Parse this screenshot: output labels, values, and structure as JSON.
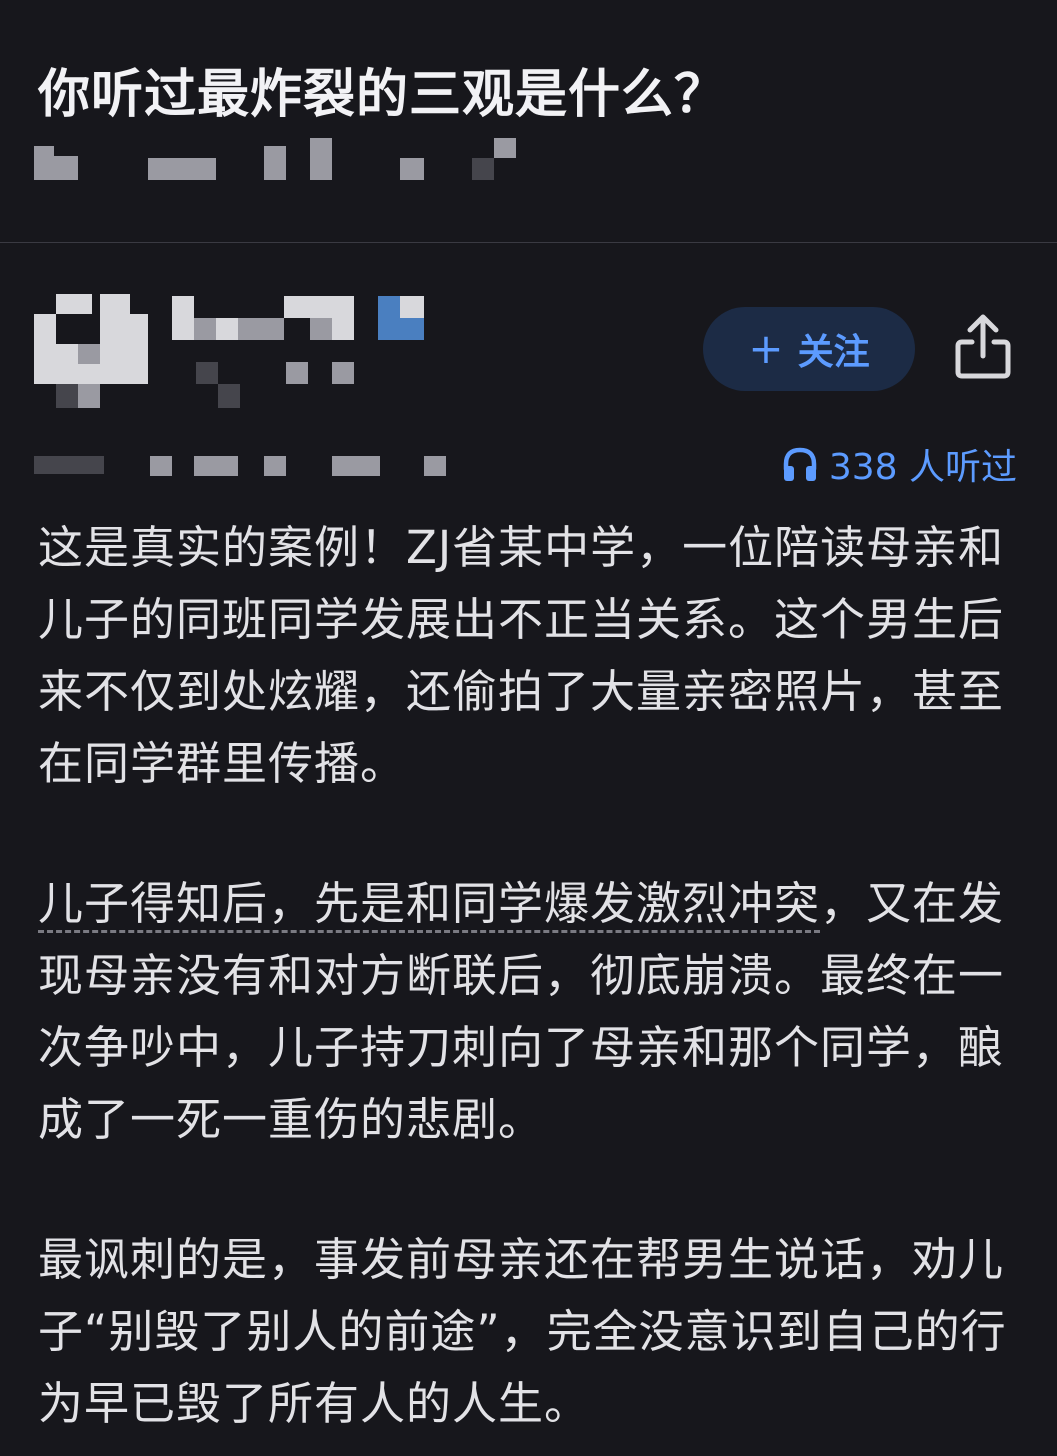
{
  "question": {
    "title": "你听过最炸裂的三观是什么？"
  },
  "author": {
    "follow_label": "关注",
    "follow_icon": "plus-icon",
    "share_icon": "share-icon"
  },
  "stats": {
    "listen_icon": "headphones-icon",
    "listen_count": "338 人听过"
  },
  "answer": {
    "paragraph_1": "这是真实的案例！ZJ省某中学，一位陪读母亲和儿子的同班同学发展出不正当关系。这个男生后来不仅到处炫耀，还偷拍了大量亲密照片，甚至在同学群里传播。",
    "paragraph_2_underlined": "儿子得知后，先是和同学爆发激烈冲突",
    "paragraph_2_rest": "，又在发现母亲没有和对方断联后，彻底崩溃。最终在一次争吵中，儿子持刀刺向了母亲和那个同学，酿成了一死一重伤的悲剧。",
    "paragraph_3": "最讽刺的是，事发前母亲还在帮男生说话，劝儿子“别毁了别人的前途”，完全没意识到自己的行为早已毁了所有人的人生。"
  },
  "colors": {
    "background": "#17171c",
    "accent_blue": "#5c9bff",
    "follow_bg": "#1c2b45",
    "text": "#e2e2e6"
  }
}
